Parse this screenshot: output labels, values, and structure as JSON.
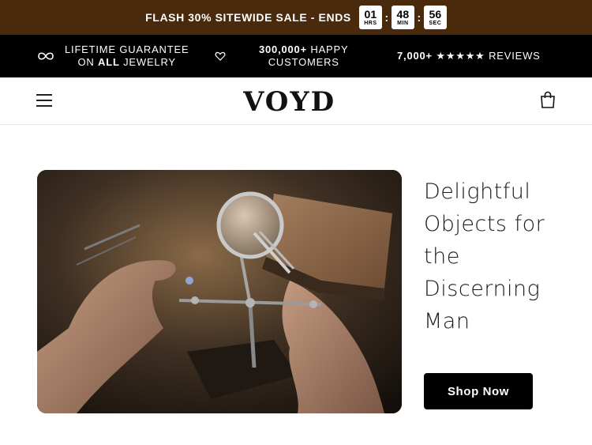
{
  "announcement": {
    "message": "FLASH 30% SITEWIDE SALE - ENDS",
    "timer": [
      {
        "value": "01",
        "unit": "HRS"
      },
      {
        "value": "48",
        "unit": "MIN"
      },
      {
        "value": "56",
        "unit": "SEC"
      }
    ],
    "separator": ":",
    "background": "#4a2a0c"
  },
  "trust_bar": {
    "guarantee_line1": "LIFETIME GUARANTEE",
    "guarantee_line2_pre": "ON ",
    "guarantee_line2_bold": "ALL",
    "guarantee_line2_post": " JEWELRY",
    "customers_line1_bold": "300,000+",
    "customers_line1_post": " HAPPY",
    "customers_line2": "CUSTOMERS",
    "reviews_bold": "7,000+",
    "reviews_stars": "★★★★★",
    "reviews_post": "REVIEWS",
    "icons": [
      "infinity-icon",
      "heart-icon"
    ]
  },
  "header": {
    "logo": "VOYD",
    "icons": [
      "menu-icon",
      "cart-icon"
    ]
  },
  "hero": {
    "title_lines": [
      "Delightful",
      "Objects for",
      "the",
      "Discerning",
      "Man"
    ],
    "button_label": "Shop Now",
    "image_alt": "jeweler working with magnifying glass"
  },
  "colors": {
    "announcement_bg": "#4a2a0c",
    "trust_bg": "#000000",
    "button_bg": "#000000"
  }
}
